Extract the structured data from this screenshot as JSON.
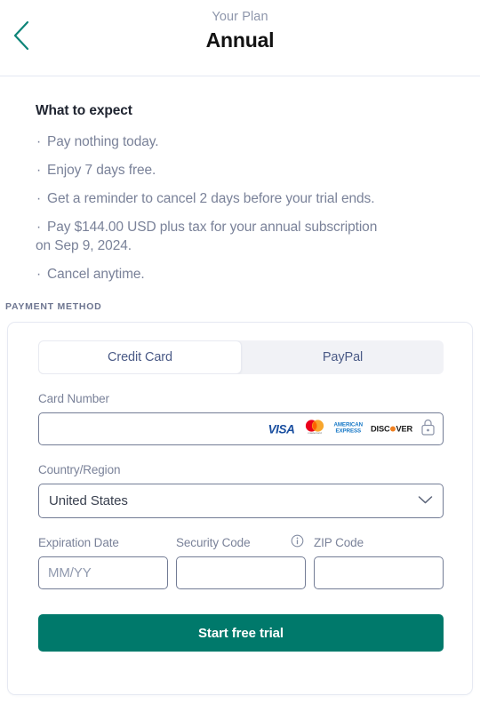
{
  "header": {
    "back_icon": "chevron-left-icon",
    "eyebrow": "Your Plan",
    "title": "Annual",
    "accent_color": "#0d8478"
  },
  "expect": {
    "title": "What to expect",
    "bullet_glyph": "·",
    "items": [
      {
        "text": "Pay nothing today."
      },
      {
        "text": "Enjoy 7 days free."
      },
      {
        "text": "Get a reminder to cancel 2 days before your trial ends."
      },
      {
        "text": "Pay $144.00 USD plus tax for your annual subscription",
        "wrap": "on Sep 9, 2024."
      },
      {
        "text": "Cancel anytime."
      }
    ]
  },
  "payment": {
    "section_label": "PAYMENT METHOD",
    "tabs": [
      {
        "label": "Credit Card",
        "selected": true
      },
      {
        "label": "PayPal",
        "selected": false
      }
    ],
    "card_number": {
      "label": "Card Number",
      "value": "",
      "placeholder": "",
      "brands": [
        "VISA",
        "mastercard",
        "AMERICAN EXPRESS",
        "DISCOVER"
      ],
      "amex_line1": "AMERICAN",
      "amex_line2": "EXPRESS",
      "discover_pre": "DISC",
      "discover_post": "VER",
      "lock_icon": "lock-icon"
    },
    "country": {
      "label": "Country/Region",
      "value": "United States",
      "chevron_icon": "chevron-down-icon"
    },
    "expiration": {
      "label": "Expiration Date",
      "value": "",
      "placeholder": "MM/YY"
    },
    "security_code": {
      "label": "Security Code",
      "value": "",
      "placeholder": "",
      "info_icon": "info-icon"
    },
    "zip": {
      "label": "ZIP Code",
      "value": "",
      "placeholder": ""
    },
    "submit_label": "Start free trial",
    "submit_color": "#00796b"
  }
}
